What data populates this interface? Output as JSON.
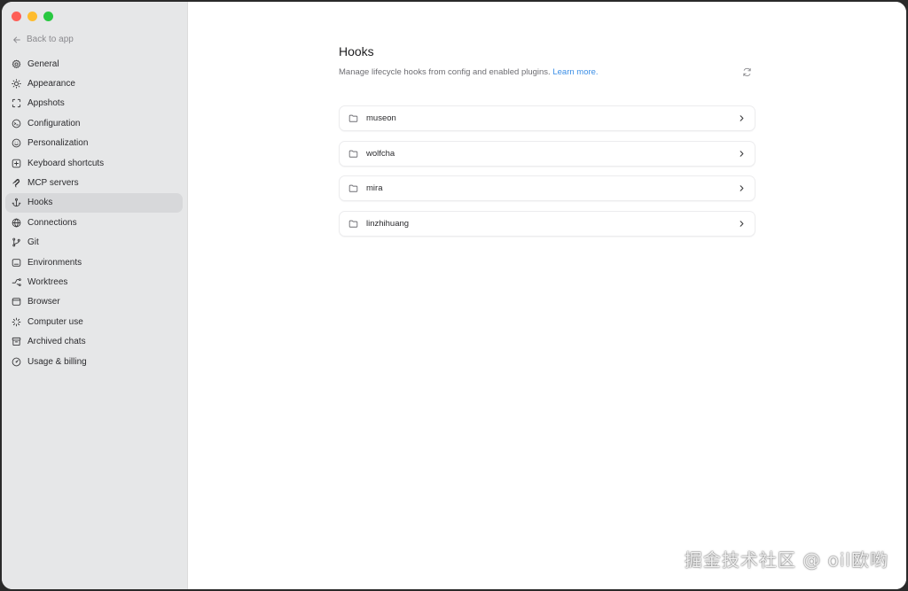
{
  "sidebar": {
    "back_label": "Back to app",
    "items": [
      {
        "label": "General",
        "icon": "gear-icon"
      },
      {
        "label": "Appearance",
        "icon": "sun-icon"
      },
      {
        "label": "Appshots",
        "icon": "screenshot-icon"
      },
      {
        "label": "Configuration",
        "icon": "configuration-icon"
      },
      {
        "label": "Personalization",
        "icon": "personalization-icon"
      },
      {
        "label": "Keyboard shortcuts",
        "icon": "keyboard-icon"
      },
      {
        "label": "MCP servers",
        "icon": "mcp-icon"
      },
      {
        "label": "Hooks",
        "icon": "anchor-icon",
        "active": true
      },
      {
        "label": "Connections",
        "icon": "globe-icon"
      },
      {
        "label": "Git",
        "icon": "git-branch-icon"
      },
      {
        "label": "Environments",
        "icon": "environment-icon"
      },
      {
        "label": "Worktrees",
        "icon": "worktree-icon"
      },
      {
        "label": "Browser",
        "icon": "browser-icon"
      },
      {
        "label": "Computer use",
        "icon": "sparkle-icon"
      },
      {
        "label": "Archived chats",
        "icon": "archive-icon"
      },
      {
        "label": "Usage & billing",
        "icon": "gauge-icon"
      }
    ]
  },
  "main": {
    "title": "Hooks",
    "subtitle": "Manage lifecycle hooks from config and enabled plugins.",
    "learn_more": "Learn more.",
    "hooks": [
      {
        "name": "museon"
      },
      {
        "name": "wolfcha"
      },
      {
        "name": "mira"
      },
      {
        "name": "linzhihuang"
      }
    ]
  },
  "watermark": "掘金技术社区 @ oil欧哟",
  "colors": {
    "sidebar_bg": "#e6e7e8",
    "active_item_bg": "#d7d8da",
    "link": "#3a8ee6"
  }
}
